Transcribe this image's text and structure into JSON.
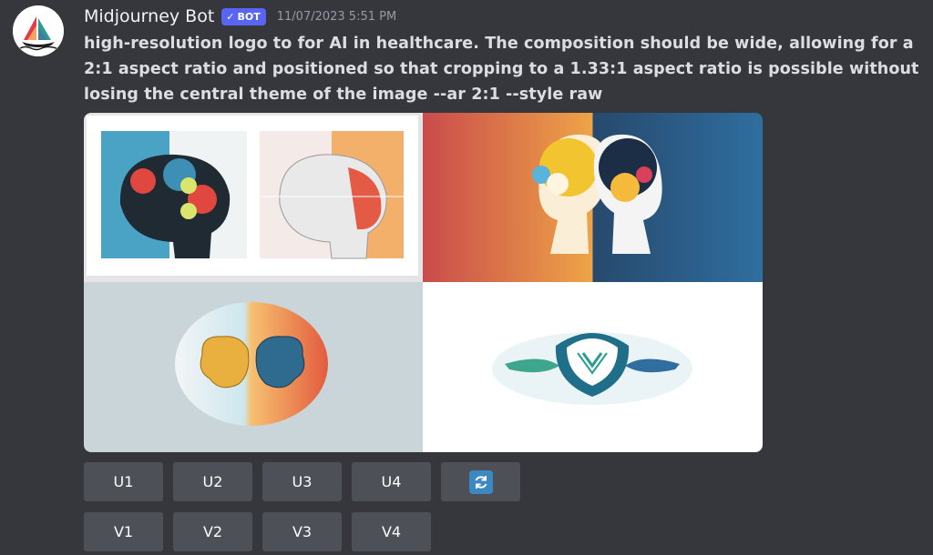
{
  "message": {
    "author": "Midjourney Bot",
    "badge": "BOT",
    "timestamp": "11/07/2023 5:51 PM",
    "text": "high-resolution logo to for AI in healthcare. The composition should be wide, allowing for a 2:1 aspect ratio and positioned so that cropping to a 1.33:1 aspect ratio is possible without losing the central theme of the image --ar 2:1 --style raw"
  },
  "buttons": {
    "upscale": [
      "U1",
      "U2",
      "U3",
      "U4"
    ],
    "variation": [
      "V1",
      "V2",
      "V3",
      "V4"
    ],
    "reroll_icon": "refresh-icon"
  },
  "colors": {
    "background": "#36373d",
    "button": "#4e5058",
    "badge": "#5865f2",
    "timestamp": "#949ba4"
  }
}
